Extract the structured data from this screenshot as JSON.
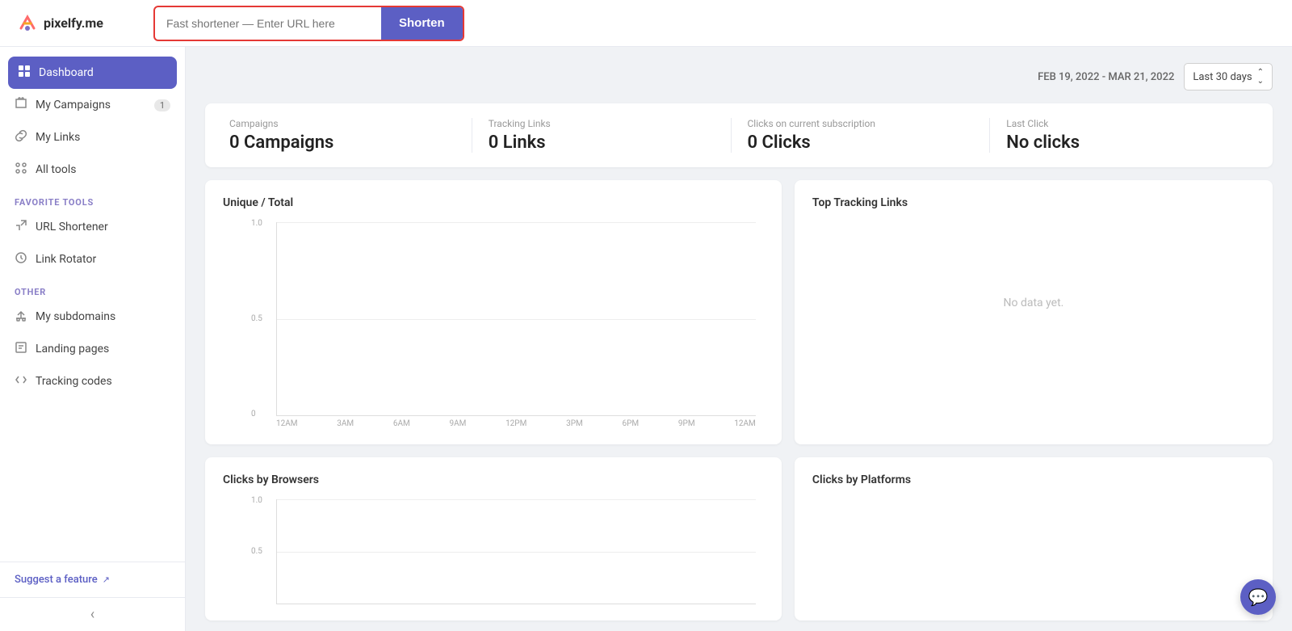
{
  "brand": {
    "name": "pixelfy.me"
  },
  "topbar": {
    "url_placeholder": "Fast shortener — Enter URL here",
    "shorten_label": "Shorten"
  },
  "sidebar": {
    "nav_items": [
      {
        "id": "dashboard",
        "label": "Dashboard",
        "icon": "⬤",
        "active": true,
        "badge": null
      },
      {
        "id": "campaigns",
        "label": "My Campaigns",
        "icon": "📁",
        "active": false,
        "badge": "1"
      },
      {
        "id": "links",
        "label": "My Links",
        "icon": "🔗",
        "active": false,
        "badge": null
      },
      {
        "id": "all-tools",
        "label": "All tools",
        "icon": "⚙",
        "active": false,
        "badge": null
      }
    ],
    "favorite_tools_label": "FAVORITE TOOLS",
    "favorite_tools": [
      {
        "id": "url-shortener",
        "label": "URL Shortener",
        "icon": "✂"
      },
      {
        "id": "link-rotator",
        "label": "Link Rotator",
        "icon": "🔄"
      }
    ],
    "other_label": "OTHER",
    "other_items": [
      {
        "id": "subdomains",
        "label": "My subdomains",
        "icon": "🏠"
      },
      {
        "id": "landing-pages",
        "label": "Landing pages",
        "icon": "📄"
      },
      {
        "id": "tracking-codes",
        "label": "Tracking codes",
        "icon": "<>"
      }
    ],
    "suggest_feature_label": "Suggest a feature",
    "collapse_icon": "‹"
  },
  "date_filter": {
    "range_text": "FEB 19, 2022 - MAR 21, 2022",
    "dropdown_label": "Last 30 days"
  },
  "stats": [
    {
      "label": "Campaigns",
      "value": "0 Campaigns"
    },
    {
      "label": "Tracking Links",
      "value": "0 Links"
    },
    {
      "label": "Clicks on current subscription",
      "value": "0 Clicks"
    },
    {
      "label": "Last Click",
      "value": "No clicks"
    }
  ],
  "charts": {
    "unique_total": {
      "title": "Unique / Total",
      "y_labels": [
        "1.0",
        "0.5",
        "0"
      ],
      "x_labels": [
        "12AM",
        "3AM",
        "6AM",
        "9AM",
        "12PM",
        "3PM",
        "6PM",
        "9PM",
        "12AM"
      ]
    },
    "top_tracking": {
      "title": "Top Tracking Links",
      "no_data": "No data yet."
    },
    "clicks_browsers": {
      "title": "Clicks by Browsers",
      "y_labels": [
        "1.0",
        "0.5"
      ]
    },
    "clicks_platforms": {
      "title": "Clicks by Platforms"
    }
  }
}
